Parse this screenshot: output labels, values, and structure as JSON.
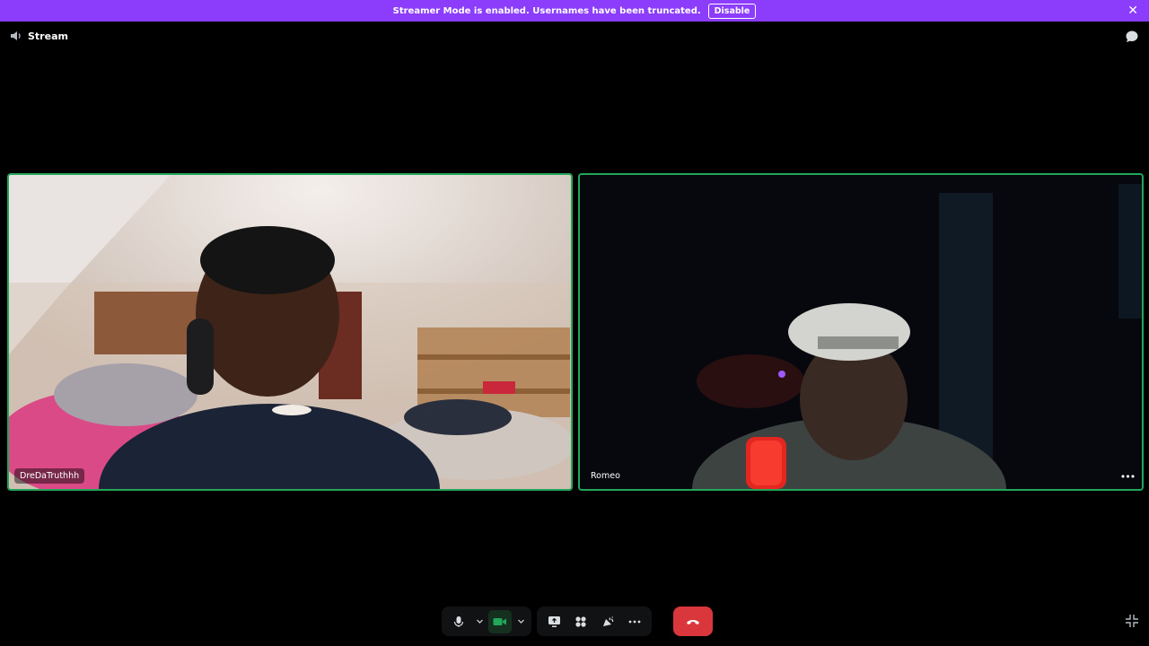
{
  "banner": {
    "message": "Streamer Mode is enabled. Usernames have been truncated.",
    "disable_label": "Disable",
    "color": "#8b3dfb"
  },
  "header": {
    "title": "Stream",
    "icon": "speaker-icon",
    "chat_icon": "chat-bubble-icon"
  },
  "participants": [
    {
      "name": "DreDaTruthhh",
      "speaking_border": "#23a55a"
    },
    {
      "name": "Romeo",
      "speaking_border": "#23a55a"
    }
  ],
  "controls": {
    "mic_icon": "microphone-icon",
    "camera_icon": "video-camera-icon",
    "screen_share_icon": "screen-share-icon",
    "activities_icon": "activities-icon",
    "soundboard_icon": "soundboard-icon",
    "more_icon": "more-dots-icon",
    "leave_icon": "hang-up-icon",
    "leave_color": "#da373c",
    "fullscreen_icon": "exit-fullscreen-icon"
  }
}
